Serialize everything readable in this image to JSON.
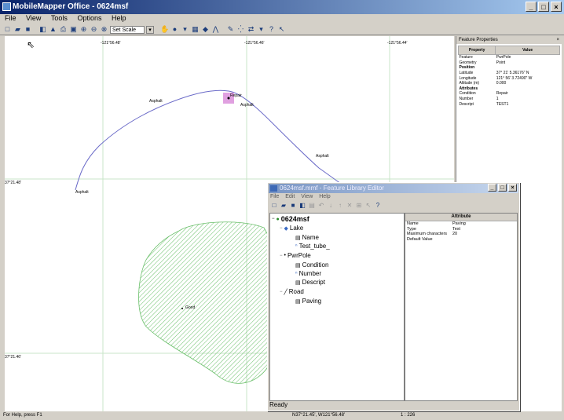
{
  "app": {
    "title": "MobileMapper Office - 0624msf",
    "window_buttons": [
      "_",
      "□",
      "×"
    ]
  },
  "menu": [
    "File",
    "View",
    "Tools",
    "Options",
    "Help"
  ],
  "toolbar": {
    "scale_value": "Set Scale"
  },
  "map": {
    "top_coords": [
      "-121°56.48'",
      "-121°56.46'",
      "-121°56.44'"
    ],
    "left_coords": [
      "37°21.48'",
      "37°21.46'"
    ],
    "labels": {
      "repair": "Repair",
      "asphalt": "Asphalt",
      "good": "Good"
    }
  },
  "feature_panel": {
    "title": "Feature Properties",
    "close": "×",
    "columns": [
      "Property",
      "Value"
    ],
    "rows": [
      {
        "k": "Feature",
        "v": "PwrPole",
        "bold": false
      },
      {
        "k": "Geometry",
        "v": "Point",
        "bold": false
      },
      {
        "k": "Position",
        "v": "",
        "bold": true
      },
      {
        "k": "Latitude",
        "v": "37° 21' 5.36176\" N",
        "bold": false
      },
      {
        "k": "Longitude",
        "v": "121° 56' 3.72490\" W",
        "bold": false
      },
      {
        "k": "Altitude (m)",
        "v": "0.000",
        "bold": false
      },
      {
        "k": "Attributes",
        "v": "",
        "bold": true
      },
      {
        "k": "Condition",
        "v": "Repair",
        "bold": false
      },
      {
        "k": "Number",
        "v": "1",
        "bold": false
      },
      {
        "k": "Descript",
        "v": "TEST1",
        "bold": false
      }
    ]
  },
  "status": {
    "left": "For Help, press F1",
    "coords": "N37°21.45', W121°56.48'",
    "scale": "1 : 226"
  },
  "dialog": {
    "title": "0624msf.mmf - Feature Library Editor",
    "menu": [
      "File",
      "Edit",
      "View",
      "Help"
    ],
    "tree": {
      "root": "0624msf",
      "lake": "Lake",
      "lake_children": [
        "Name",
        "Test_tube_"
      ],
      "pwrpole": "PwrPole",
      "pwrpole_children": [
        "Condition",
        "Number",
        "Descript"
      ],
      "road": "Road",
      "road_children": [
        "Paving"
      ]
    },
    "attr_header": "Attribute",
    "attr_rows": [
      {
        "k": "Name",
        "v": "Paving"
      },
      {
        "k": "Type",
        "v": "Text"
      },
      {
        "k": "Maximum characters",
        "v": "20"
      },
      {
        "k": "Default Value",
        "v": ""
      }
    ],
    "status": "Ready"
  },
  "colors": {
    "road_line": "#6a6ac8",
    "polygon_hatch": "#6abf6a",
    "selection": "#e0a0e0"
  }
}
